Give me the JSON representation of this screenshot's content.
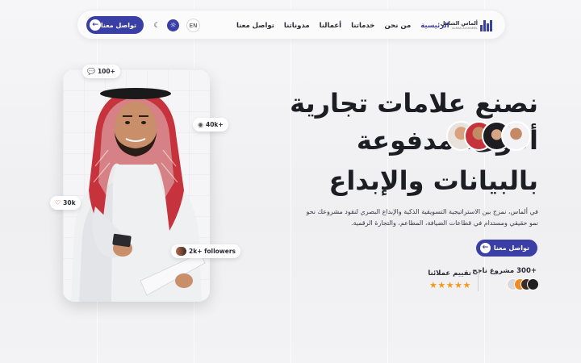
{
  "nav": {
    "cta_label": "تواصل معنا",
    "lang_label": "EN",
    "links": [
      {
        "label": "الرئيسية",
        "active": true
      },
      {
        "label": "من نحن",
        "active": false
      },
      {
        "label": "خدماتنا",
        "active": false
      },
      {
        "label": "أعمالنا",
        "active": false
      },
      {
        "label": "مدوناتنا",
        "active": false
      },
      {
        "label": "تواصل معنا",
        "active": false
      }
    ],
    "logo_text": "ألماس الشامل",
    "logo_subtext": "ALMAS ALSHAMEL"
  },
  "hero": {
    "title_line1": "نصنع علامات تجارية",
    "title_line2": "أقوى، مدفوعة",
    "title_line3": "بالبيانات والإبداع",
    "description": "في ألماس، نمزج بين الاستراتيجية التسويقية الذكية والإبداع البصري لنقود مشروعك نحو نمو حقيقي ومستدام في قطاعات الضيافة، المطاعم، والتجارة الرقمية.",
    "cta_label": "تواصل معنا"
  },
  "stats": {
    "projects_label": "+300 مشروع ناجح",
    "rating_label": "تقييم عملائنا",
    "stars": "★★★★★",
    "rating": 5
  },
  "social_pills": {
    "comments": "100+",
    "views": "40k+",
    "likes": "30k",
    "followers": "2k+ followers"
  },
  "colors": {
    "accent": "#3a3fa6",
    "star": "#f29a1f",
    "text": "#1d1d24"
  },
  "icons": {
    "comment": "comment-icon",
    "eye": "eye-icon",
    "heart": "heart-icon",
    "moon": "moon-icon",
    "sun": "sun-icon",
    "arrow": "arrow-left-icon"
  }
}
